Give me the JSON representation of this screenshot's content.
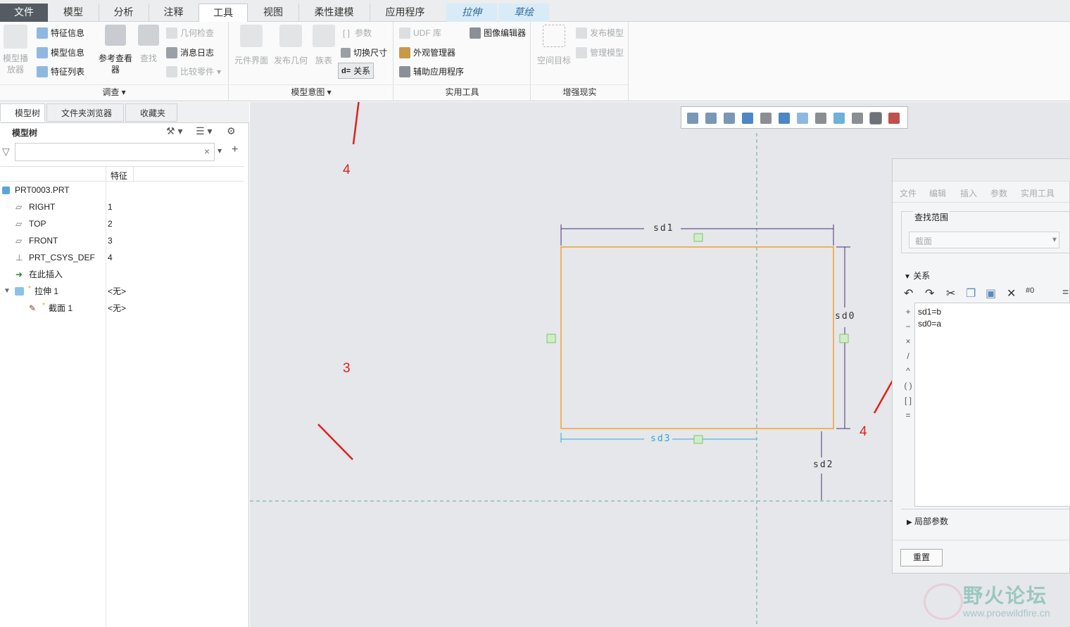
{
  "menu": {
    "tabs": [
      "文件",
      "模型",
      "分析",
      "注释",
      "工具",
      "视图",
      "柔性建模",
      "应用程序",
      "拉伸",
      "草绘"
    ]
  },
  "ribbon": {
    "investigate": {
      "playback": "模型播放器",
      "feature_info": "特征信息",
      "model_info": "模型信息",
      "feature_list": "特征列表",
      "ref_viewer": "参考查看器",
      "find": "查找",
      "geom_check": "几何检查",
      "message_log": "消息日志",
      "compare_part": "比较零件",
      "label": "调查"
    },
    "intent": {
      "comp_interface": "元件界面",
      "publish_geom": "发布几何",
      "family_table": "族表",
      "params": "参数",
      "switch_dims": "切换尺寸",
      "relations": "关系",
      "label": "模型意图"
    },
    "utilities": {
      "udf": "UDF 库",
      "image_editor": "图像编辑器",
      "appearance": "外观管理器",
      "aux_app": "辅助应用程序",
      "label": "实用工具"
    },
    "ar": {
      "space_target": "空间目标",
      "publish_model": "发布模型",
      "manage_model": "管理模型",
      "label": "增强现实"
    }
  },
  "left": {
    "tabs": [
      "模型树",
      "文件夹浏览器",
      "收藏夹"
    ],
    "title": "模型树",
    "col_header": "特征",
    "rows": [
      {
        "name": "PRT0003.PRT",
        "val": ""
      },
      {
        "name": "RIGHT",
        "val": "1"
      },
      {
        "name": "TOP",
        "val": "2"
      },
      {
        "name": "FRONT",
        "val": "3"
      },
      {
        "name": "PRT_CSYS_DEF",
        "val": "4"
      },
      {
        "name": "在此插入",
        "val": ""
      },
      {
        "name": "拉伸 1",
        "val": "<无>"
      },
      {
        "name": "截面 1",
        "val": "<无>"
      }
    ]
  },
  "annotations": {
    "a3": "3",
    "a4a": "4",
    "a4b": "4"
  },
  "sketch": {
    "dims": {
      "sd0": "sd0",
      "sd1": "sd1",
      "sd2": "sd2",
      "sd3": "sd3"
    }
  },
  "relations": {
    "menu": [
      "文件",
      "编辑",
      "插入",
      "参数",
      "实用工具"
    ],
    "search_label": "查找范围",
    "search_value": "截面",
    "section_title": "关系",
    "lines": [
      "sd1=b",
      "sd0=a"
    ],
    "local_params": "局部参数",
    "reset": "重置"
  },
  "watermark": {
    "cn": "野火论坛",
    "url": "www.proewildfire.cn"
  }
}
